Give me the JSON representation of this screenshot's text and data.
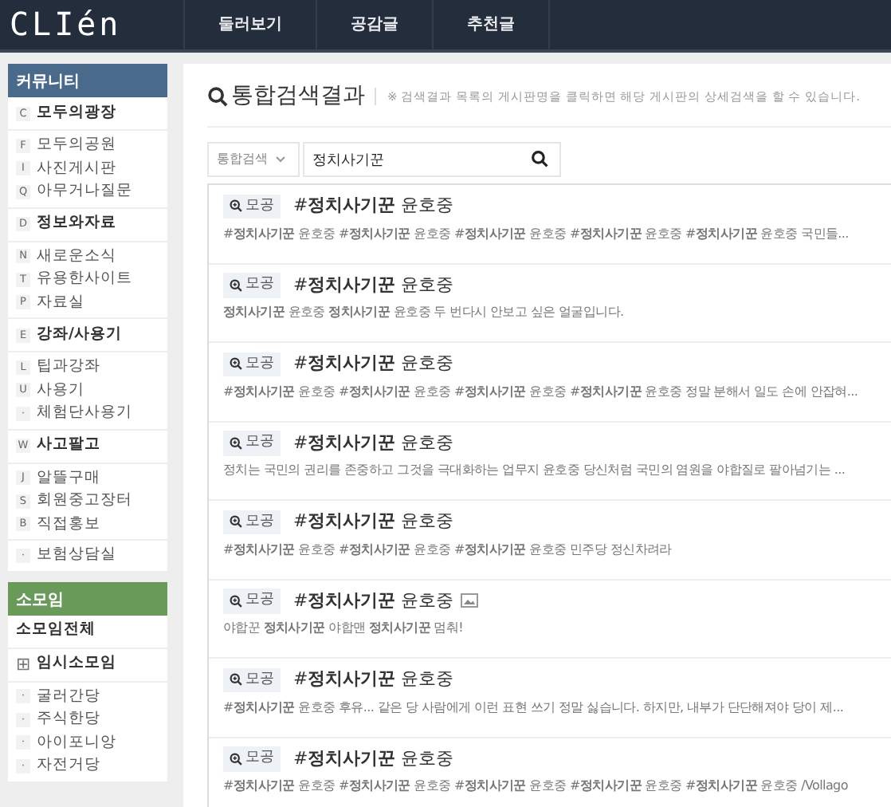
{
  "header": {
    "logo": "CLIén",
    "nav": [
      {
        "label": "둘러보기",
        "selected": false
      },
      {
        "label": "공감글",
        "selected": false
      },
      {
        "label": "추천글",
        "selected": false
      }
    ]
  },
  "sidebar": [
    {
      "title": "커뮤니티",
      "color": "#4a6a8c",
      "groups": [
        [
          {
            "key": "C",
            "label": "모두의광장",
            "kind": "heading"
          }
        ],
        [
          {
            "key": "F",
            "label": "모두의공원",
            "kind": "link"
          },
          {
            "key": "I",
            "label": "사진게시판",
            "kind": "link"
          },
          {
            "key": "Q",
            "label": "아무거나질문",
            "kind": "link"
          }
        ],
        [
          {
            "key": "D",
            "label": "정보와자료",
            "kind": "heading"
          }
        ],
        [
          {
            "key": "N",
            "label": "새로운소식",
            "kind": "link"
          },
          {
            "key": "T",
            "label": "유용한사이트",
            "kind": "link"
          },
          {
            "key": "P",
            "label": "자료실",
            "kind": "link"
          }
        ],
        [
          {
            "key": "E",
            "label": "강좌/사용기",
            "kind": "heading"
          }
        ],
        [
          {
            "key": "L",
            "label": "팁과강좌",
            "kind": "link"
          },
          {
            "key": "U",
            "label": "사용기",
            "kind": "link"
          },
          {
            "key": "·",
            "label": "체험단사용기",
            "kind": "link"
          }
        ],
        [
          {
            "key": "W",
            "label": "사고팔고",
            "kind": "heading"
          }
        ],
        [
          {
            "key": "J",
            "label": "알뜰구매",
            "kind": "link"
          },
          {
            "key": "S",
            "label": "회원중고장터",
            "kind": "link"
          },
          {
            "key": "B",
            "label": "직접홍보",
            "kind": "link"
          }
        ],
        [
          {
            "key": "·",
            "label": "보험상담실",
            "kind": "link"
          }
        ]
      ]
    },
    {
      "title": "소모임",
      "color": "#6a9a5a",
      "groups": [
        [
          {
            "label": "소모임전체",
            "kind": "heading"
          }
        ],
        [
          {
            "key": "⊞",
            "label": "임시소모임",
            "kind": "heading"
          }
        ],
        [
          {
            "key": "·",
            "label": "굴러간당",
            "kind": "link"
          },
          {
            "key": "·",
            "label": "주식한당",
            "kind": "link"
          },
          {
            "key": "·",
            "label": "아이포니앙",
            "kind": "link"
          },
          {
            "key": "·",
            "label": "자전거당",
            "kind": "link"
          }
        ]
      ]
    }
  ],
  "page": {
    "title": "통합검색결과",
    "note": "※ 검색결과 목록의 게시판명을 클릭하면 해당 게시판의 상세검색을 할 수 있습니다."
  },
  "search": {
    "scope": "통합검색",
    "value": "정치사기꾼"
  },
  "results": [
    {
      "board": "모공",
      "title": "#**정치사기꾼** 윤호중",
      "has_image": false,
      "snippet": "#**정치사기꾼** 윤호중 #**정치사기꾼** 윤호중 #**정치사기꾼** 윤호중 #**정치사기꾼** 윤호중 #**정치사기꾼** 윤호중 국민들..."
    },
    {
      "board": "모공",
      "title": "#**정치사기꾼** 윤호중",
      "has_image": false,
      "snippet": "**정치사기꾼** 윤호중 **정치사기꾼** 윤호중 두 번다시 안보고 싶은 얼굴입니다."
    },
    {
      "board": "모공",
      "title": "#**정치사기꾼** 윤호중",
      "has_image": false,
      "snippet": "#**정치사기꾼** 윤호중 #**정치사기꾼** 윤호중 #**정치사기꾼** 윤호중 #**정치사기꾼** 윤호중 정말 분해서 일도 손에 안잡혀..."
    },
    {
      "board": "모공",
      "title": "#**정치사기꾼** 윤호중",
      "has_image": false,
      "snippet": "정치는 국민의 권리를 존중하고 그것을 극대화하는 업무지 윤호중 당신처럼 국민의 염원을 야합질로 팔아넘기는 ..."
    },
    {
      "board": "모공",
      "title": "#**정치사기꾼** 윤호중",
      "has_image": false,
      "snippet": "#**정치사기꾼** 윤호중 #**정치사기꾼** 윤호중 #**정치사기꾼** 윤호중 민주당 정신차려라"
    },
    {
      "board": "모공",
      "title": "#**정치사기꾼** 윤호중",
      "has_image": true,
      "snippet": "야합꾼 **정치사기꾼** 야합맨 **정치사기꾼** 멈춰!"
    },
    {
      "board": "모공",
      "title": "#**정치사기꾼** 윤호중",
      "has_image": false,
      "snippet": "#**정치사기꾼** 윤호중 후유... 같은 당 사람에게 이런 표현 쓰기 정말 싫습니다. 하지만, 내부가 단단해져야 당이 제..."
    },
    {
      "board": "모공",
      "title": "#**정치사기꾼** 윤호중",
      "has_image": false,
      "snippet": "#**정치사기꾼** 윤호중 #**정치사기꾼** 윤호중 #**정치사기꾼** 윤호중 #**정치사기꾼** 윤호중 #**정치사기꾼** 윤호중 /Vollago"
    }
  ]
}
